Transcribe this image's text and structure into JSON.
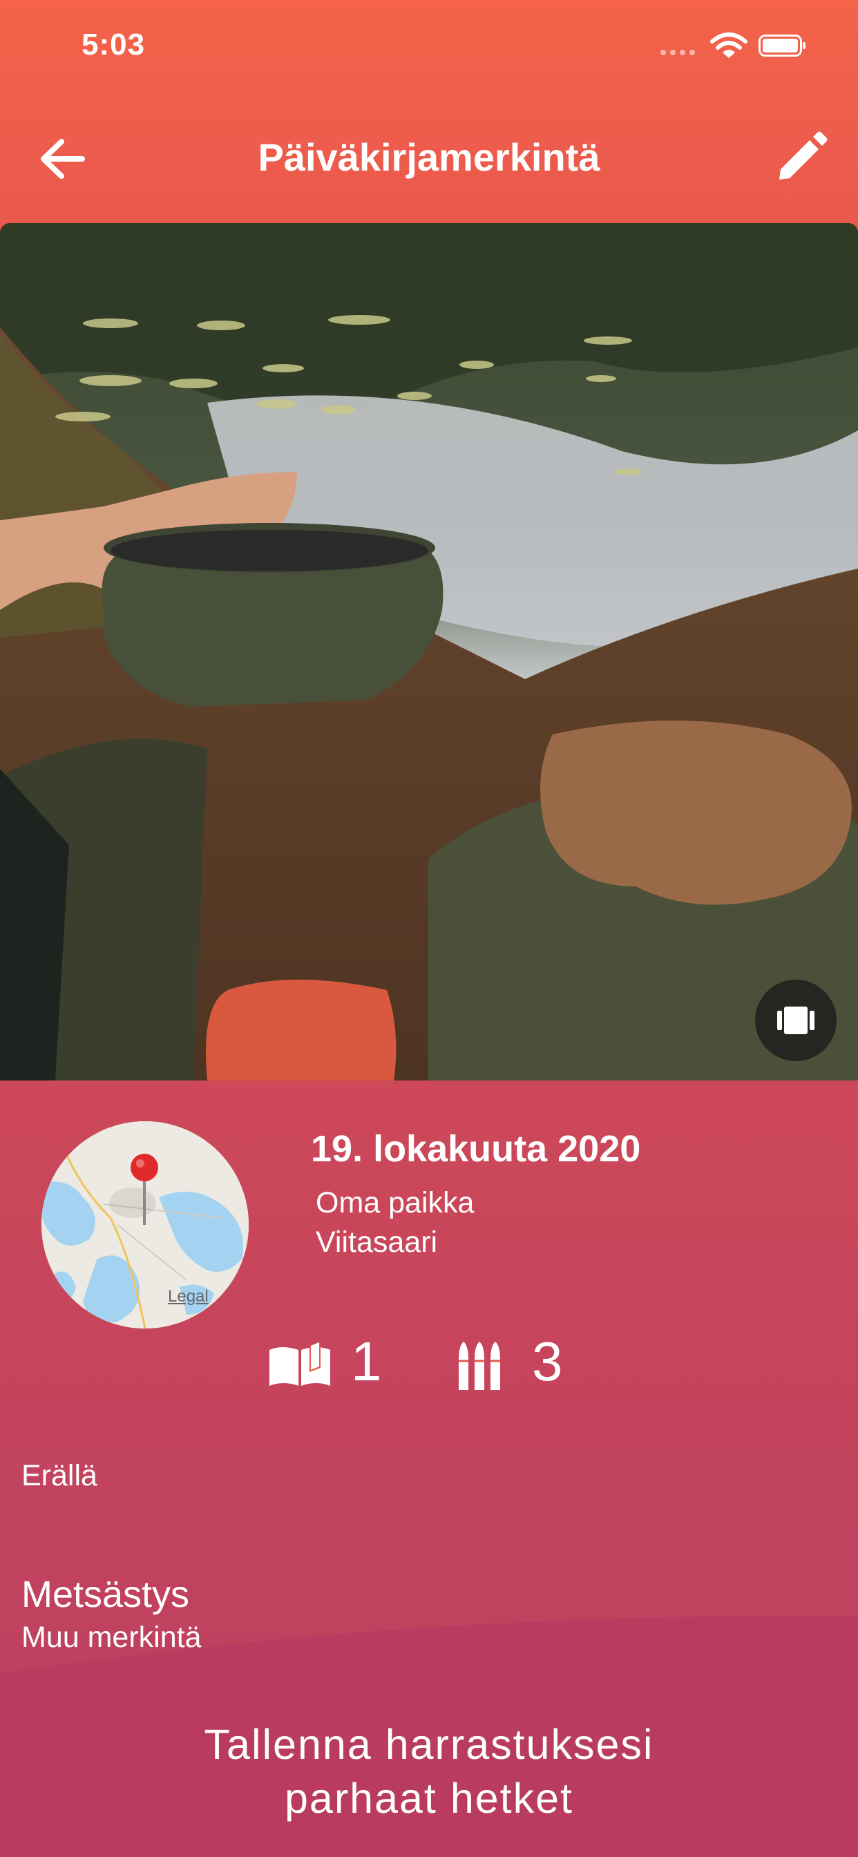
{
  "status_bar": {
    "time": "5:03"
  },
  "nav": {
    "title": "Päiväkirjamerkintä",
    "back_icon": "arrow-left-icon",
    "edit_icon": "pencil-icon"
  },
  "entry": {
    "date": "19. lokakuuta 2020",
    "place_name": "Oma paikka",
    "place_city": "Viitasaari",
    "map_legal": "Legal",
    "stats": {
      "book_count": "1",
      "ammo_count": "3"
    },
    "category": "Erällä",
    "type": "Metsästys",
    "subtype": "Muu merkintä"
  },
  "footer": {
    "line1": "Tallenna harrastuksesi",
    "line2": "parhaat hetket"
  },
  "colors": {
    "header_top": "#f4634a",
    "background_bottom": "#bc3f60",
    "footer": "#b93c60"
  }
}
